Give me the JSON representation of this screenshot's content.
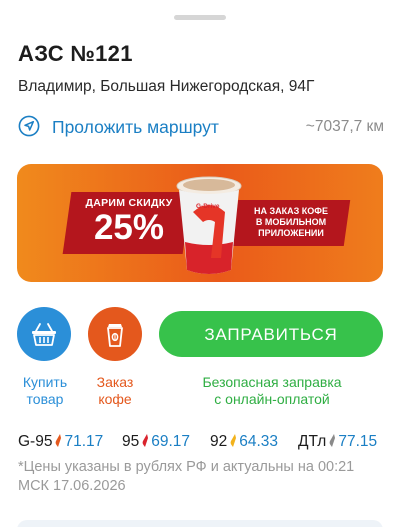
{
  "station": {
    "title": "АЗС №121",
    "address": "Владимир, Большая Нижегородская, 94Г"
  },
  "route": {
    "label": "Проложить маршрут",
    "distance": "~7037,7 км",
    "icon": "navigation-arrow-icon"
  },
  "promo": {
    "text_top": "ДАРИМ СКИДКУ",
    "discount": "25%",
    "text_right_1": "НА ЗАКАЗ КОФЕ",
    "text_right_2": "В МОБИЛЬНОМ",
    "text_right_3": "ПРИЛОЖЕНИИ",
    "cup_brand": "G-Drive"
  },
  "actions": {
    "shop_label_1": "Купить",
    "shop_label_2": "товар",
    "coffee_label_1": "Заказ",
    "coffee_label_2": "кофе",
    "refuel_button": "ЗАПРАВИТЬСЯ",
    "pay_note_1": "Безопасная заправка",
    "pay_note_2": "с онлайн-оплатой"
  },
  "prices": [
    {
      "fuel": "G-95",
      "value": "71.17",
      "color": "#e4581d"
    },
    {
      "fuel": "95",
      "value": "69.17",
      "color": "#d9232d"
    },
    {
      "fuel": "92",
      "value": "64.33",
      "color": "#f2b21b"
    },
    {
      "fuel": "ДТл",
      "value": "77.15",
      "color": "#8a8a8a"
    }
  ],
  "prices_note": "*Цены указаны в рублях РФ и актуальны на 00:21 МСК 17.06.2026",
  "colors": {
    "accent_blue": "#1b7fc4",
    "shop_blue": "#2b8fd8",
    "coffee_orange": "#e4581d",
    "refuel_green": "#37c24b"
  }
}
